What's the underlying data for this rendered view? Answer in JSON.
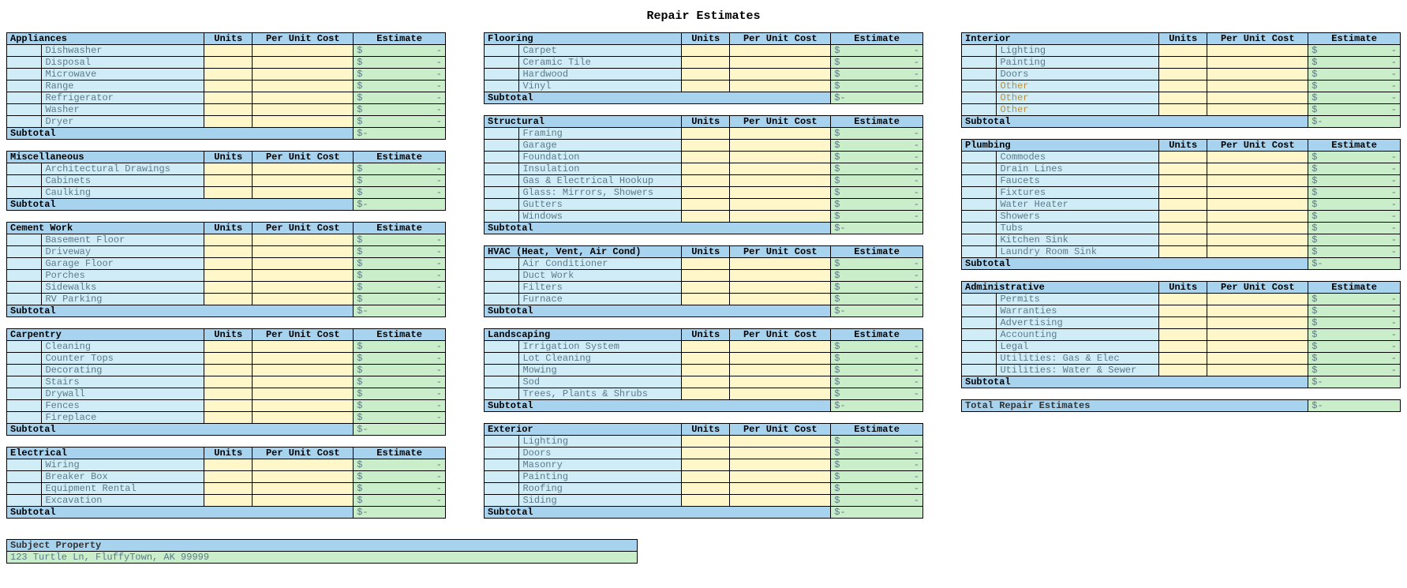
{
  "title": "Repair Estimates",
  "headers": {
    "units": "Units",
    "per_unit": "Per Unit Cost",
    "estimate": "Estimate"
  },
  "currency": "$",
  "dash": "-",
  "subtotal_label": "Subtotal",
  "total_label": "Total Repair Estimates",
  "subject_label": "Subject Property",
  "subject_value": "123 Turtle Ln, FluffyTown, AK 99999",
  "columns": [
    [
      {
        "name": "Appliances",
        "items": [
          {
            "label": "Dishwasher"
          },
          {
            "label": "Disposal"
          },
          {
            "label": "Microwave"
          },
          {
            "label": "Range"
          },
          {
            "label": "Refrigerator"
          },
          {
            "label": "Washer"
          },
          {
            "label": "Dryer"
          }
        ]
      },
      {
        "name": "Miscellaneous",
        "items": [
          {
            "label": "Architectural Drawings"
          },
          {
            "label": "Cabinets"
          },
          {
            "label": "Caulking"
          }
        ]
      },
      {
        "name": "Cement Work",
        "items": [
          {
            "label": "Basement Floor"
          },
          {
            "label": "Driveway"
          },
          {
            "label": "Garage Floor"
          },
          {
            "label": "Porches"
          },
          {
            "label": "Sidewalks"
          },
          {
            "label": "RV Parking"
          }
        ]
      },
      {
        "name": "Carpentry",
        "items": [
          {
            "label": "Cleaning"
          },
          {
            "label": "Counter Tops"
          },
          {
            "label": "Decorating"
          },
          {
            "label": "Stairs"
          },
          {
            "label": "Drywall"
          },
          {
            "label": "Fences"
          },
          {
            "label": "Fireplace"
          }
        ]
      },
      {
        "name": "Electrical",
        "items": [
          {
            "label": "Wiring"
          },
          {
            "label": "Breaker Box"
          },
          {
            "label": "Equipment Rental"
          },
          {
            "label": "Excavation"
          }
        ]
      }
    ],
    [
      {
        "name": "Flooring",
        "items": [
          {
            "label": "Carpet"
          },
          {
            "label": "Ceramic Tile"
          },
          {
            "label": "Hardwood"
          },
          {
            "label": "Vinyl"
          }
        ]
      },
      {
        "name": "Structural",
        "items": [
          {
            "label": "Framing"
          },
          {
            "label": "Garage"
          },
          {
            "label": "Foundation"
          },
          {
            "label": "Insulation"
          },
          {
            "label": "Gas & Electrical Hookup"
          },
          {
            "label": "Glass: Mirrors, Showers"
          },
          {
            "label": "Gutters"
          },
          {
            "label": "Windows"
          }
        ]
      },
      {
        "name": "HVAC (Heat, Vent, Air Cond)",
        "items": [
          {
            "label": "Air Conditioner"
          },
          {
            "label": "Duct Work"
          },
          {
            "label": "Filters"
          },
          {
            "label": "Furnace"
          }
        ]
      },
      {
        "name": "Landscaping",
        "items": [
          {
            "label": "Irrigation System"
          },
          {
            "label": "Lot Cleaning"
          },
          {
            "label": "Mowing"
          },
          {
            "label": "Sod"
          },
          {
            "label": "Trees, Plants & Shrubs"
          }
        ]
      },
      {
        "name": "Exterior",
        "items": [
          {
            "label": "Lighting"
          },
          {
            "label": "Doors"
          },
          {
            "label": "Masonry"
          },
          {
            "label": "Painting"
          },
          {
            "label": "Roofing"
          },
          {
            "label": "Siding"
          }
        ]
      }
    ],
    [
      {
        "name": "Interior",
        "items": [
          {
            "label": "Lighting"
          },
          {
            "label": "Painting"
          },
          {
            "label": "Doors"
          },
          {
            "label": "Other",
            "other": true
          },
          {
            "label": "Other",
            "other": true
          },
          {
            "label": "Other",
            "other": true
          }
        ]
      },
      {
        "name": "Plumbing",
        "items": [
          {
            "label": "Commodes"
          },
          {
            "label": "Drain Lines"
          },
          {
            "label": "Faucets"
          },
          {
            "label": "Fixtures"
          },
          {
            "label": "Water Heater"
          },
          {
            "label": "Showers"
          },
          {
            "label": "Tubs"
          },
          {
            "label": "Kitchen Sink"
          },
          {
            "label": "Laundry Room Sink"
          }
        ]
      },
      {
        "name": "Administrative",
        "items": [
          {
            "label": "Permits"
          },
          {
            "label": "Warranties"
          },
          {
            "label": "Advertising"
          },
          {
            "label": "Accounting"
          },
          {
            "label": "Legal"
          },
          {
            "label": "Utilities: Gas & Elec"
          },
          {
            "label": "Utilities: Water & Sewer"
          }
        ]
      }
    ]
  ]
}
